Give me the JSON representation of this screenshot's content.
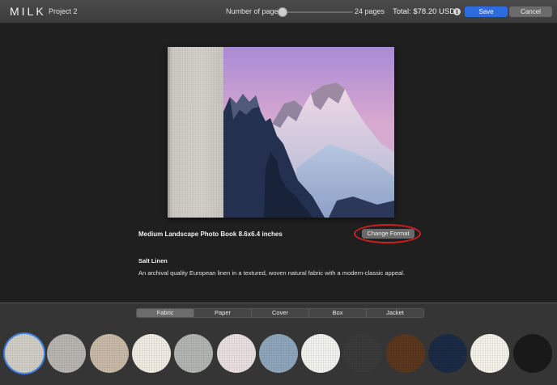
{
  "app": {
    "logo": "MILK",
    "project": "Project 2"
  },
  "toolbar": {
    "pages_label": "Number of pages",
    "pages_value": "24 pages",
    "pages_slider_fraction": 0.0,
    "total": "Total: $78.20 USD",
    "info_icon": "info-icon",
    "save_label": "Save",
    "cancel_label": "Cancel"
  },
  "book": {
    "title": "Medium Landscape Photo Book 8.6x6.4 inches",
    "change_format_label": "Change Format",
    "cover_image": "snow-capped mountain peaks at dusk"
  },
  "material": {
    "name": "Salt Linen",
    "description": "An archival quality European linen in a textured, woven natural fabric with a modern-classic appeal."
  },
  "tabs": [
    {
      "label": "Fabric",
      "active": true
    },
    {
      "label": "Paper",
      "active": false
    },
    {
      "label": "Cover",
      "active": false
    },
    {
      "label": "Box",
      "active": false
    },
    {
      "label": "Jacket",
      "active": false
    }
  ],
  "swatches": [
    {
      "color": "#d2cfc6",
      "selected": true
    },
    {
      "color": "#b9b6b2",
      "selected": false
    },
    {
      "color": "#c9bba8",
      "selected": false
    },
    {
      "color": "#f1ede3",
      "selected": false
    },
    {
      "color": "#b3b6b3",
      "selected": false
    },
    {
      "color": "#ebe0e2",
      "selected": false
    },
    {
      "color": "#8fa7bd",
      "selected": false
    },
    {
      "color": "#f3f3ef",
      "selected": false
    },
    {
      "color": "#3a3a3a",
      "selected": false
    },
    {
      "color": "#5b371d",
      "selected": false
    },
    {
      "color": "#1b2a45",
      "selected": false
    },
    {
      "color": "#f6f3ea",
      "selected": false
    },
    {
      "color": "#1a1a1a",
      "selected": false
    }
  ]
}
